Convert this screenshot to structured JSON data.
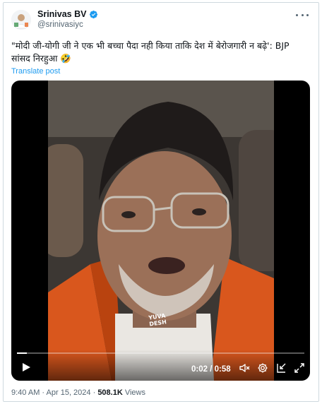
{
  "author": {
    "name": "Srinivas BV",
    "handle": "@srinivasiyc"
  },
  "tweet": {
    "text": "\"मोदी जी-योगी जी ने एक भी बच्चा पैदा नही किया ताकि देश में बेरोजगारी न बढ़े': BJP सांसद निरहुआ 🤣",
    "translate_label": "Translate post"
  },
  "video": {
    "watermark": "YUVA DESH",
    "time_display": "0:02 / 0:58",
    "progress_fraction": 0.035
  },
  "meta": {
    "time": "9:40 AM",
    "sep1": " · ",
    "date": "Apr 15, 2024",
    "sep2": " · ",
    "views_count": "508.1K",
    "views_label": " Views"
  },
  "colors": {
    "accent": "#1d9bf0",
    "verified": "#1d9bf0",
    "muted": "#536471"
  }
}
